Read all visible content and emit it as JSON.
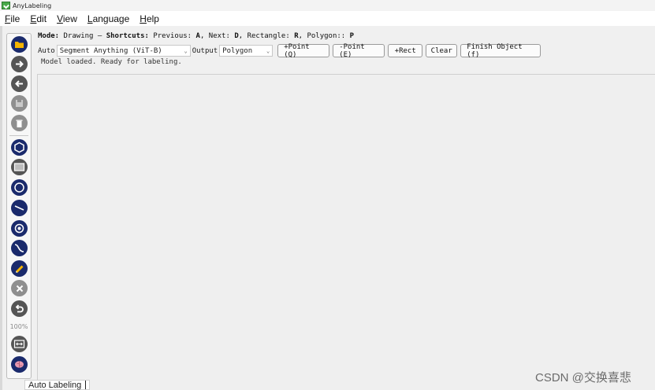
{
  "window": {
    "title": "AnyLabeling",
    "app_icon": "app-logo-icon"
  },
  "menu": [
    {
      "first": "F",
      "rest": "ile"
    },
    {
      "first": "E",
      "rest": "dit"
    },
    {
      "first": "V",
      "rest": "iew"
    },
    {
      "first": "L",
      "rest": "anguage"
    },
    {
      "first": "H",
      "rest": "elp"
    }
  ],
  "toolbar": {
    "icons": [
      "open-folder-icon",
      "next-image-icon",
      "previous-image-icon",
      "save-icon",
      "delete-file-icon",
      "create-polygon-icon",
      "create-rectangle-icon",
      "create-circle-icon",
      "create-line-icon",
      "create-point-icon",
      "create-linestrip-icon",
      "edit-icon",
      "delete-shape-icon",
      "undo-icon",
      "fit-width-icon",
      "auto-labeling-brain-icon"
    ],
    "zoom": "100%"
  },
  "mode_line": {
    "mode_label": "Mode:",
    "mode_value": "Drawing",
    "dash": "–",
    "shortcuts_label": "Shortcuts:",
    "prev_text": "Previous:",
    "prev_key": "A",
    "next_text": ", Next:",
    "next_key": "D",
    "rect_text": ", Rectangle:",
    "rect_key": "R",
    "poly_text": ", Polygon::",
    "poly_key": "P"
  },
  "auto": {
    "label": "Auto",
    "model": "Segment Anything (ViT-B)",
    "output_label": "Output",
    "output": "Polygon",
    "buttons": {
      "add_point": "+Point (Q)",
      "remove_point": "-Point (E)",
      "add_rect": "+Rect",
      "clear": "Clear",
      "finish": "Finish Object (f)"
    },
    "status": "Model loaded. Ready for labeling."
  },
  "tooltip": "Auto Labeling",
  "watermark": "CSDN @交换喜悲",
  "colors": {
    "icon_navy": "#1a2a6c",
    "icon_gray": "#8f8f8f",
    "folder_yellow": "#f5b400",
    "brain_pink": "#e89ab0"
  }
}
